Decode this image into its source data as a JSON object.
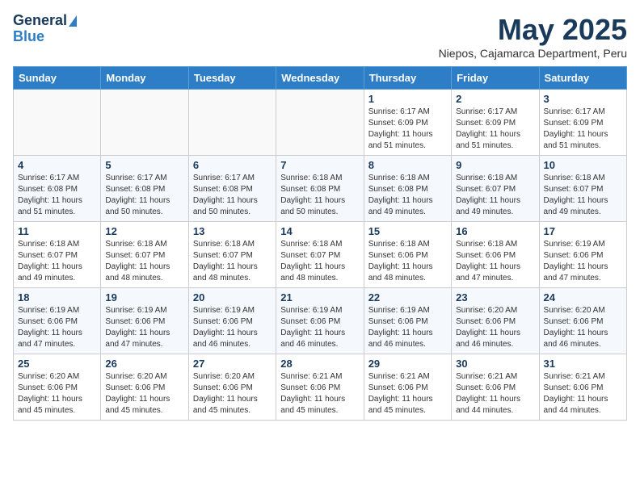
{
  "logo": {
    "line1": "General",
    "line2": "Blue"
  },
  "title": "May 2025",
  "subtitle": "Niepos, Cajamarca Department, Peru",
  "days_of_week": [
    "Sunday",
    "Monday",
    "Tuesday",
    "Wednesday",
    "Thursday",
    "Friday",
    "Saturday"
  ],
  "weeks": [
    [
      {
        "day": "",
        "info": ""
      },
      {
        "day": "",
        "info": ""
      },
      {
        "day": "",
        "info": ""
      },
      {
        "day": "",
        "info": ""
      },
      {
        "day": "1",
        "info": "Sunrise: 6:17 AM\nSunset: 6:09 PM\nDaylight: 11 hours\nand 51 minutes."
      },
      {
        "day": "2",
        "info": "Sunrise: 6:17 AM\nSunset: 6:09 PM\nDaylight: 11 hours\nand 51 minutes."
      },
      {
        "day": "3",
        "info": "Sunrise: 6:17 AM\nSunset: 6:09 PM\nDaylight: 11 hours\nand 51 minutes."
      }
    ],
    [
      {
        "day": "4",
        "info": "Sunrise: 6:17 AM\nSunset: 6:08 PM\nDaylight: 11 hours\nand 51 minutes."
      },
      {
        "day": "5",
        "info": "Sunrise: 6:17 AM\nSunset: 6:08 PM\nDaylight: 11 hours\nand 50 minutes."
      },
      {
        "day": "6",
        "info": "Sunrise: 6:17 AM\nSunset: 6:08 PM\nDaylight: 11 hours\nand 50 minutes."
      },
      {
        "day": "7",
        "info": "Sunrise: 6:18 AM\nSunset: 6:08 PM\nDaylight: 11 hours\nand 50 minutes."
      },
      {
        "day": "8",
        "info": "Sunrise: 6:18 AM\nSunset: 6:08 PM\nDaylight: 11 hours\nand 49 minutes."
      },
      {
        "day": "9",
        "info": "Sunrise: 6:18 AM\nSunset: 6:07 PM\nDaylight: 11 hours\nand 49 minutes."
      },
      {
        "day": "10",
        "info": "Sunrise: 6:18 AM\nSunset: 6:07 PM\nDaylight: 11 hours\nand 49 minutes."
      }
    ],
    [
      {
        "day": "11",
        "info": "Sunrise: 6:18 AM\nSunset: 6:07 PM\nDaylight: 11 hours\nand 49 minutes."
      },
      {
        "day": "12",
        "info": "Sunrise: 6:18 AM\nSunset: 6:07 PM\nDaylight: 11 hours\nand 48 minutes."
      },
      {
        "day": "13",
        "info": "Sunrise: 6:18 AM\nSunset: 6:07 PM\nDaylight: 11 hours\nand 48 minutes."
      },
      {
        "day": "14",
        "info": "Sunrise: 6:18 AM\nSunset: 6:07 PM\nDaylight: 11 hours\nand 48 minutes."
      },
      {
        "day": "15",
        "info": "Sunrise: 6:18 AM\nSunset: 6:06 PM\nDaylight: 11 hours\nand 48 minutes."
      },
      {
        "day": "16",
        "info": "Sunrise: 6:18 AM\nSunset: 6:06 PM\nDaylight: 11 hours\nand 47 minutes."
      },
      {
        "day": "17",
        "info": "Sunrise: 6:19 AM\nSunset: 6:06 PM\nDaylight: 11 hours\nand 47 minutes."
      }
    ],
    [
      {
        "day": "18",
        "info": "Sunrise: 6:19 AM\nSunset: 6:06 PM\nDaylight: 11 hours\nand 47 minutes."
      },
      {
        "day": "19",
        "info": "Sunrise: 6:19 AM\nSunset: 6:06 PM\nDaylight: 11 hours\nand 47 minutes."
      },
      {
        "day": "20",
        "info": "Sunrise: 6:19 AM\nSunset: 6:06 PM\nDaylight: 11 hours\nand 46 minutes."
      },
      {
        "day": "21",
        "info": "Sunrise: 6:19 AM\nSunset: 6:06 PM\nDaylight: 11 hours\nand 46 minutes."
      },
      {
        "day": "22",
        "info": "Sunrise: 6:19 AM\nSunset: 6:06 PM\nDaylight: 11 hours\nand 46 minutes."
      },
      {
        "day": "23",
        "info": "Sunrise: 6:20 AM\nSunset: 6:06 PM\nDaylight: 11 hours\nand 46 minutes."
      },
      {
        "day": "24",
        "info": "Sunrise: 6:20 AM\nSunset: 6:06 PM\nDaylight: 11 hours\nand 46 minutes."
      }
    ],
    [
      {
        "day": "25",
        "info": "Sunrise: 6:20 AM\nSunset: 6:06 PM\nDaylight: 11 hours\nand 45 minutes."
      },
      {
        "day": "26",
        "info": "Sunrise: 6:20 AM\nSunset: 6:06 PM\nDaylight: 11 hours\nand 45 minutes."
      },
      {
        "day": "27",
        "info": "Sunrise: 6:20 AM\nSunset: 6:06 PM\nDaylight: 11 hours\nand 45 minutes."
      },
      {
        "day": "28",
        "info": "Sunrise: 6:21 AM\nSunset: 6:06 PM\nDaylight: 11 hours\nand 45 minutes."
      },
      {
        "day": "29",
        "info": "Sunrise: 6:21 AM\nSunset: 6:06 PM\nDaylight: 11 hours\nand 45 minutes."
      },
      {
        "day": "30",
        "info": "Sunrise: 6:21 AM\nSunset: 6:06 PM\nDaylight: 11 hours\nand 44 minutes."
      },
      {
        "day": "31",
        "info": "Sunrise: 6:21 AM\nSunset: 6:06 PM\nDaylight: 11 hours\nand 44 minutes."
      }
    ]
  ]
}
